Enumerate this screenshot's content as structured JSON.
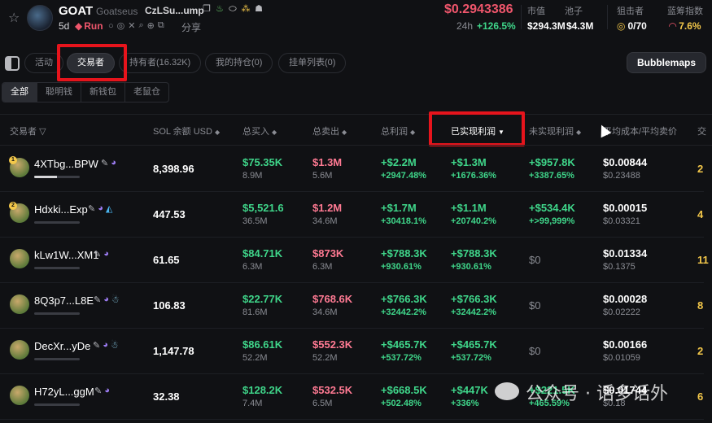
{
  "header": {
    "token_name": "GOAT",
    "token_full": "Goatseus",
    "token_addr": "CzLSu...ump",
    "age": "5d",
    "status": "Run",
    "share": "分享",
    "price": "$0.2943386",
    "change_label": "24h",
    "change_value": "+126.5%",
    "market_cap_label": "市值",
    "market_cap_value": "$294.3M",
    "pool_label": "池子",
    "pool_value": "$4.3M",
    "sniper_label": "狙击者",
    "sniper_value": "0/70",
    "chip_label": "蓝筹指数",
    "chip_value": "7.6%"
  },
  "tabs": [
    {
      "label": "活动"
    },
    {
      "label": "交易者"
    },
    {
      "label": "持有者(16.32K)"
    },
    {
      "label": "我的持仓(0)"
    },
    {
      "label": "挂单列表(0)"
    }
  ],
  "bubblemaps_label": "Bubblemaps",
  "sub_tabs": [
    {
      "label": "全部"
    },
    {
      "label": "聪明钱"
    },
    {
      "label": "新钱包"
    },
    {
      "label": "老鼠仓"
    }
  ],
  "columns": {
    "trader": "交易者",
    "sol_balance": "SOL 余额 USD",
    "bought": "总买入",
    "sold": "总卖出",
    "total_profit": "总利润",
    "realized": "已实现利润",
    "unrealized": "未实现利润",
    "avg_cost": "平均成本/平均卖价",
    "last": "交"
  },
  "rows": [
    {
      "rank": "1",
      "addr": "4XTbg...BPW",
      "bar_fill": 0.5,
      "sol": "8,398.96",
      "buy": "$75.35K",
      "buy_sub": "8.9M",
      "sell": "$1.3M",
      "sell_sub": "5.6M",
      "profit": "+$2.2M",
      "profit_pct": "+2947.48%",
      "realized": "+$1.3M",
      "realized_pct": "+1676.36%",
      "unreal": "+$957.8K",
      "unreal_pct": "+3387.65%",
      "cost": "$0.00844",
      "cost_sub": "$0.23488",
      "last": "2"
    },
    {
      "rank": "2",
      "addr": "Hdxki...Exp",
      "bar_fill": 0.0,
      "sol": "447.53",
      "buy": "$5,521.6",
      "buy_sub": "36.5M",
      "sell": "$1.2M",
      "sell_sub": "34.6M",
      "profit": "+$1.7M",
      "profit_pct": "+30418.1%",
      "realized": "+$1.1M",
      "realized_pct": "+20740.2%",
      "unreal": "+$534.4K",
      "unreal_pct": "+>99,999%",
      "cost": "$0.00015",
      "cost_sub": "$0.03321",
      "last": "4"
    },
    {
      "rank": "",
      "addr": "kLw1W...XM1",
      "bar_fill": 0.0,
      "sol": "61.65",
      "buy": "$84.71K",
      "buy_sub": "6.3M",
      "sell": "$873K",
      "sell_sub": "6.3M",
      "profit": "+$788.3K",
      "profit_pct": "+930.61%",
      "realized": "+$788.3K",
      "realized_pct": "+930.61%",
      "unreal": "$0",
      "unreal_pct": "",
      "cost": "$0.01334",
      "cost_sub": "$0.1375",
      "last": "11"
    },
    {
      "rank": "",
      "addr": "8Q3p7...L8E",
      "bar_fill": 0.0,
      "sol": "106.83",
      "buy": "$22.77K",
      "buy_sub": "81.6M",
      "sell": "$768.6K",
      "sell_sub": "34.6M",
      "profit": "+$766.3K",
      "profit_pct": "+32442.2%",
      "realized": "+$766.3K",
      "realized_pct": "+32442.2%",
      "unreal": "$0",
      "unreal_pct": "",
      "cost": "$0.00028",
      "cost_sub": "$0.02222",
      "last": "8"
    },
    {
      "rank": "",
      "addr": "DecXr...yDe",
      "bar_fill": 0.0,
      "sol": "1,147.78",
      "buy": "$86.61K",
      "buy_sub": "52.2M",
      "sell": "$552.3K",
      "sell_sub": "52.2M",
      "profit": "+$465.7K",
      "profit_pct": "+537.72%",
      "realized": "+$465.7K",
      "realized_pct": "+537.72%",
      "unreal": "$0",
      "unreal_pct": "",
      "cost": "$0.00166",
      "cost_sub": "$0.01059",
      "last": "2"
    },
    {
      "rank": "",
      "addr": "H72yL...ggM",
      "bar_fill": 0.0,
      "sol": "32.38",
      "buy": "$128.2K",
      "buy_sub": "7.4M",
      "sell": "$532.5K",
      "sell_sub": "6.5M",
      "profit": "+$668.5K",
      "profit_pct": "+502.48%",
      "realized": "+$447K",
      "realized_pct": "+336%",
      "unreal": "+$221.5K",
      "unreal_pct": "+465.59%",
      "cost": "$0.01744",
      "cost_sub": "$0.18",
      "last": "6"
    }
  ],
  "watermark": "公众号 · 话多话外"
}
